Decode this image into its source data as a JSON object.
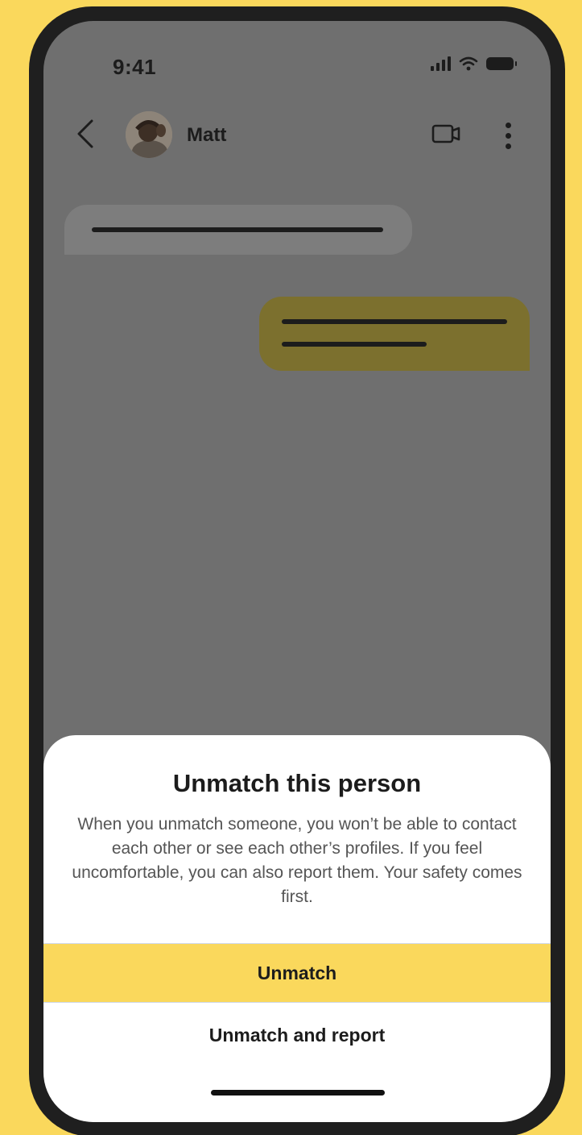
{
  "status_bar": {
    "time": "9:41",
    "icons": [
      "signal-icon",
      "wifi-icon",
      "battery-icon"
    ]
  },
  "chat_header": {
    "contact_name": "Matt",
    "icons": [
      "back-chevron-icon",
      "video-call-icon",
      "more-vertical-icon"
    ]
  },
  "sheet": {
    "title": "Unmatch this person",
    "body": "When you unmatch someone, you won’t be able to contact each other or see each other’s profiles. If you feel uncomfortable, you can also report them. Your safety comes first.",
    "primary_button": "Unmatch",
    "secondary_button": "Unmatch and report"
  },
  "colors": {
    "accent": "#FAD85C",
    "overlay": "#6f6f6f",
    "text": "#1c1c1c"
  }
}
